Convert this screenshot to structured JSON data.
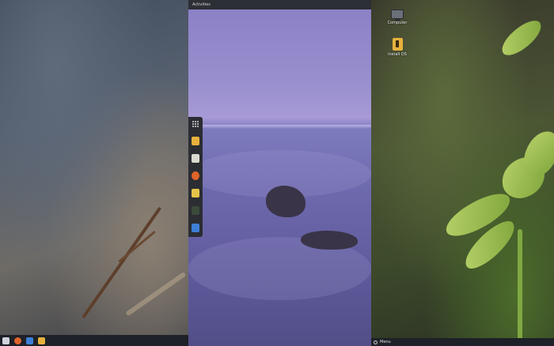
{
  "middle": {
    "topbar_label": "Activities",
    "dock_items": [
      {
        "name": "apps-grid-icon",
        "color": "#d8d8d8"
      },
      {
        "name": "installer-icon",
        "color": "#e7b13d"
      },
      {
        "name": "calculator-icon",
        "color": "#d9d9cf"
      },
      {
        "name": "firefox-icon",
        "color": "#e0642a"
      },
      {
        "name": "files-icon",
        "color": "#e6c24a"
      },
      {
        "name": "terminal-icon",
        "color": "#3a4b3a"
      },
      {
        "name": "software-store-icon",
        "color": "#3d7fd6"
      }
    ]
  },
  "right": {
    "desktop_items": [
      {
        "label": "Computer",
        "icon": "computer-icon"
      },
      {
        "label": "Install OS",
        "icon": "installer-icon"
      }
    ],
    "taskbar_menu_label": "Menu"
  },
  "left": {
    "taskbar_icons": [
      {
        "name": "apps-grid-icon",
        "color": "#cfd4dc"
      },
      {
        "name": "firefox-icon",
        "color": "#e0642a"
      },
      {
        "name": "software-store-icon",
        "color": "#3d7fd6"
      },
      {
        "name": "installer-icon",
        "color": "#e7b13d"
      }
    ]
  }
}
